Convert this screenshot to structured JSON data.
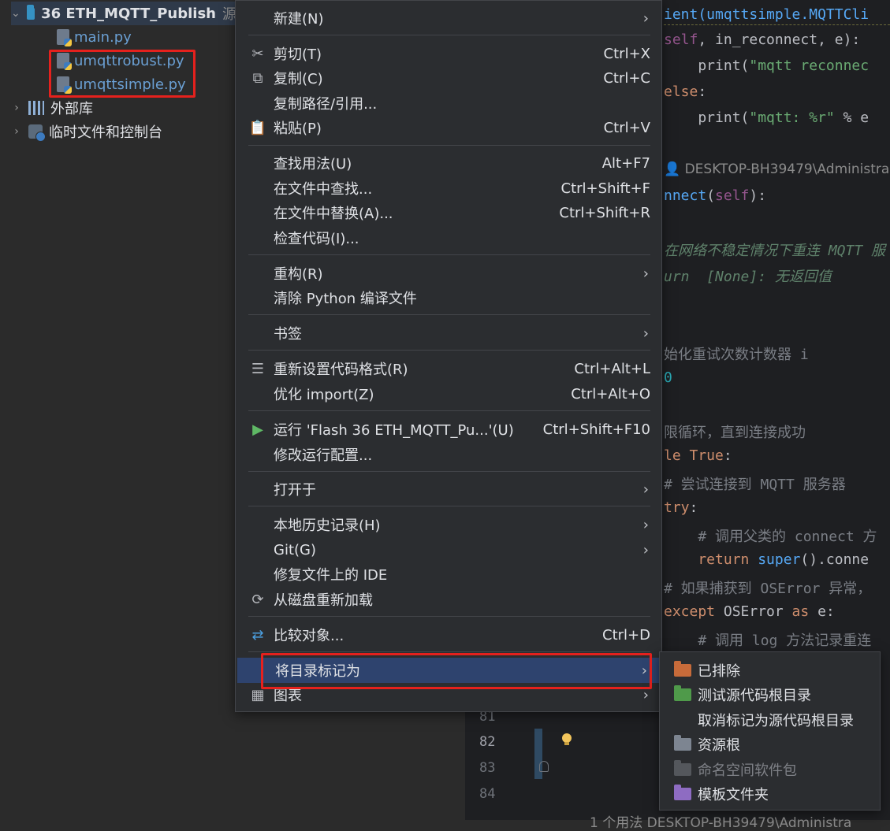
{
  "project_tree": {
    "root_folder": "36 ETH_MQTT_Publish",
    "root_suffix": "源",
    "files": [
      "main.py",
      "umqttrobust.py",
      "umqttsimple.py"
    ],
    "external_libs": "外部库",
    "scratches": "临时文件和控制台"
  },
  "editor": {
    "lines": {
      "l1a": "ient(umqttsimple.MQTTCli",
      "l2a": "self",
      "l2b": ", in_reconnect, e):",
      "l3a": "    print(",
      "l3b": "\"mqtt reconnec",
      "l4": "else",
      "l4b": ":",
      "l5a": "    print(",
      "l5b": "\"mqtt: %r\"",
      "l5c": " % e",
      "author1": "DESKTOP-BH39479\\Administra",
      "l6a": "nnect",
      "l6b": "(",
      "l6c": "self",
      "l6d": "):",
      "doc1": "在网络不稳定情况下重连 MQTT 服",
      "doc2": "urn  [None]: 无返回值",
      "c1": "始化重试次数计数器 i",
      "n1": "0",
      "c2": "限循环，直到连接成功",
      "w1": "le True",
      "w1b": ":",
      "c3": "# 尝试连接到 MQTT 服务器",
      "t1": "try",
      "t1b": ":",
      "c4": "    # 调用父类的 connect 方",
      "r1": "    return ",
      "r1b": "super",
      "r1c": "().conne",
      "c5": "# 如果捕获到 OSError 异常，",
      "e1": "except ",
      "e1b": "OSError",
      "e1c": " as ",
      "e1d": "e:",
      "c6": "    # 调用 log 方法记录重连",
      "author2": "1 个用法   DESKTOP-BH39479\\Administra"
    },
    "line_numbers": [
      "81",
      "82",
      "83",
      "84"
    ]
  },
  "context_menu": {
    "new": "新建(N)",
    "cut": "剪切(T)",
    "cut_sc": "Ctrl+X",
    "copy": "复制(C)",
    "copy_sc": "Ctrl+C",
    "copy_path": "复制路径/引用...",
    "paste": "粘贴(P)",
    "paste_sc": "Ctrl+V",
    "find_usages": "查找用法(U)",
    "find_usages_sc": "Alt+F7",
    "find_in_files": "在文件中查找...",
    "find_in_files_sc": "Ctrl+Shift+F",
    "replace_in_files": "在文件中替换(A)...",
    "replace_in_files_sc": "Ctrl+Shift+R",
    "inspect": "检查代码(I)...",
    "refactor": "重构(R)",
    "clean_python": "清除 Python 编译文件",
    "bookmarks": "书签",
    "reformat": "重新设置代码格式(R)",
    "reformat_sc": "Ctrl+Alt+L",
    "optimize_imports": "优化 import(Z)",
    "optimize_imports_sc": "Ctrl+Alt+O",
    "run": "运行 'Flash 36 ETH_MQTT_Pu...'(U)",
    "run_sc": "Ctrl+Shift+F10",
    "modify_run": "修改运行配置...",
    "open_in": "打开于",
    "local_history": "本地历史记录(H)",
    "git": "Git(G)",
    "repair_ide": "修复文件上的 IDE",
    "reload": "从磁盘重新加载",
    "compare": "比较对象...",
    "compare_sc": "Ctrl+D",
    "mark_dir": "将目录标记为",
    "diagrams": "图表"
  },
  "submenu": {
    "excluded": "已排除",
    "test_sources": "测试源代码根目录",
    "unmark": "取消标记为源代码根目录",
    "resources": "资源根",
    "namespace": "命名空间软件包",
    "templates": "模板文件夹"
  },
  "colors": {
    "highlight_box": "#e5211d",
    "menu_selected": "#2e436e",
    "excluded_folder": "#c76b3a",
    "test_folder": "#4f9a4a",
    "resources_folder": "#7d8591",
    "template_folder": "#8e6cc2"
  }
}
